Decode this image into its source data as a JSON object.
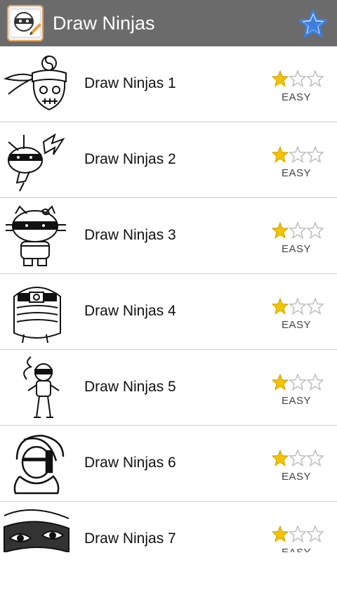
{
  "appbar": {
    "title": "Draw Ninjas",
    "icon": "pencil-ninja-app-icon",
    "favorite_icon": "star-icon"
  },
  "colors": {
    "appbar": "#6b6b6b",
    "star_filled": "#f2c400",
    "star_empty": "#bdbdbd",
    "favorite_star": "#3f7fe0"
  },
  "items": [
    {
      "title": "Draw Ninjas 1",
      "difficulty": "EASY",
      "rating": 1,
      "max_rating": 3,
      "thumb": "ninja-skull-headband"
    },
    {
      "title": "Draw Ninjas 2",
      "difficulty": "EASY",
      "rating": 1,
      "max_rating": 3,
      "thumb": "pikachu-ninja"
    },
    {
      "title": "Draw Ninjas 3",
      "difficulty": "EASY",
      "rating": 1,
      "max_rating": 3,
      "thumb": "hello-kitty-ninja"
    },
    {
      "title": "Draw Ninjas 4",
      "difficulty": "EASY",
      "rating": 1,
      "max_rating": 3,
      "thumb": "masked-ninja-skull-hood"
    },
    {
      "title": "Draw Ninjas 5",
      "difficulty": "EASY",
      "rating": 1,
      "max_rating": 3,
      "thumb": "small-ninja-standing"
    },
    {
      "title": "Draw Ninjas 6",
      "difficulty": "EASY",
      "rating": 1,
      "max_rating": 3,
      "thumb": "ninja-with-blade"
    },
    {
      "title": "Draw Ninjas 7",
      "difficulty": "EASY",
      "rating": 1,
      "max_rating": 3,
      "thumb": "ninja-eyes-mask"
    }
  ]
}
